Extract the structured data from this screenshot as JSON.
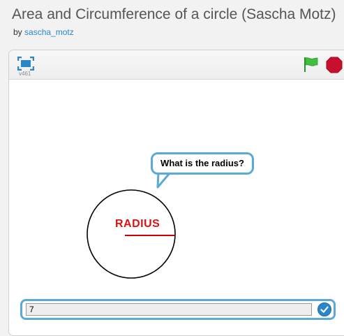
{
  "project": {
    "title": "Area and Circumference of a circle (Sascha Motz)",
    "by_prefix": "by",
    "author": "sascha_motz"
  },
  "player": {
    "version": "v461",
    "flag_color": "#3fbf3f",
    "stop_color": "#c8102e",
    "accent_color": "#5aa9d6"
  },
  "stage": {
    "speech_bubble": "What is the radius?",
    "circle_label": "RADIUS",
    "label_color": "#dd1111"
  },
  "ask_prompt": {
    "input_value": "7",
    "submit_icon": "check-icon"
  }
}
